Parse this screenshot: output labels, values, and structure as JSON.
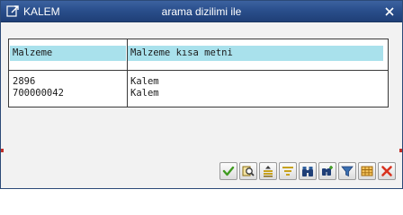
{
  "window": {
    "title_left": "KALEM",
    "title_center": "arama dizilimi ile"
  },
  "table": {
    "columns": [
      "Malzeme",
      "Malzeme kısa metni"
    ],
    "rows": [
      [
        "2896",
        "Kalem"
      ],
      [
        "700000042",
        "Kalem"
      ]
    ]
  },
  "toolbar": {
    "buttons": [
      {
        "name": "accept-check-icon",
        "color": "#3f9a1f"
      },
      {
        "name": "search-magnifier-icon",
        "color": "#c7a21c"
      },
      {
        "name": "sort-ascending-icon",
        "color": "#c7a21c"
      },
      {
        "name": "filter-list-icon",
        "color": "#c7a21c"
      },
      {
        "name": "binoculars-find-icon",
        "color": "#3a6fb0"
      },
      {
        "name": "binoculars-find-next-icon",
        "color": "#3a6fb0"
      },
      {
        "name": "funnel-filter-icon",
        "color": "#3a6fb0"
      },
      {
        "name": "grid-layout-icon",
        "color": "#e2a22a"
      },
      {
        "name": "cancel-x-icon",
        "color": "#d8321f"
      }
    ]
  },
  "colors": {
    "titlebar": "#2a4f8c",
    "header_highlight": "#a9e1ec",
    "accent_red": "#c0302a"
  }
}
